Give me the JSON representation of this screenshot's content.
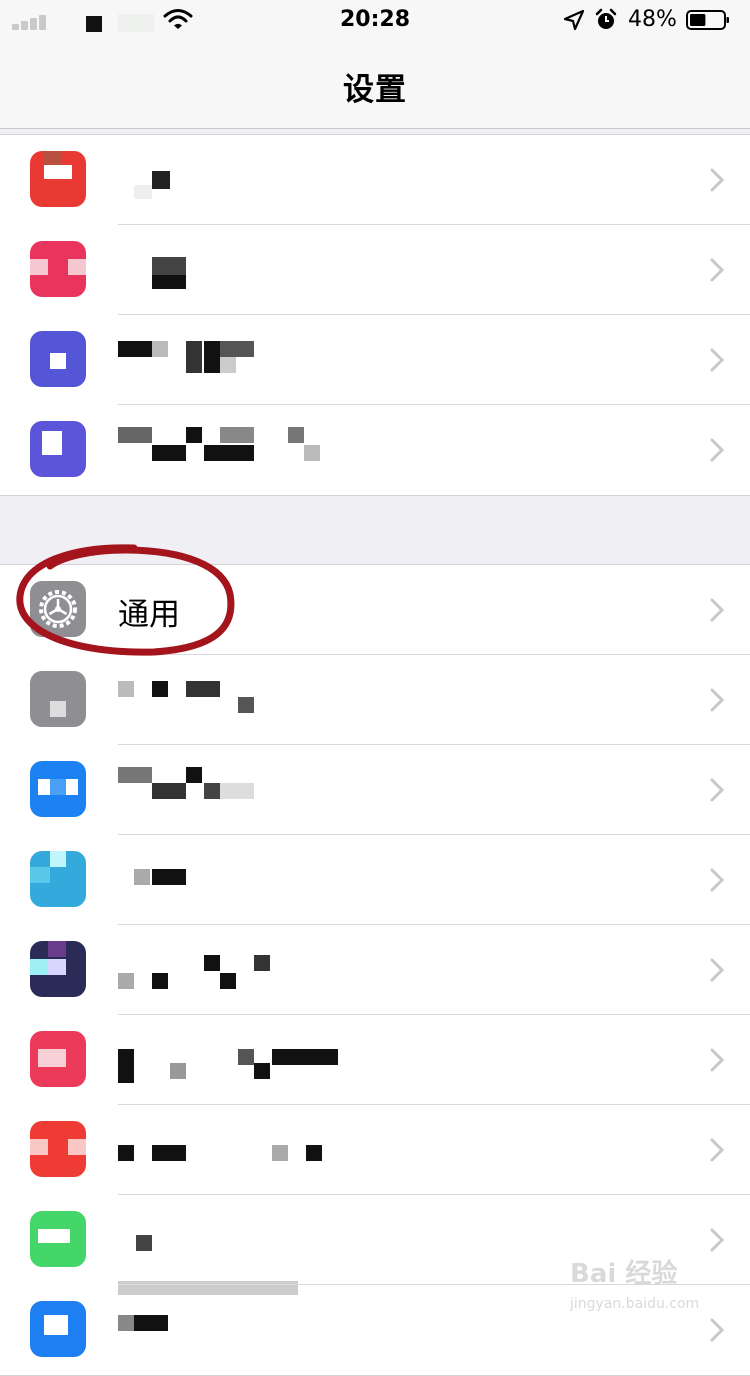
{
  "status_bar": {
    "time": "20:28",
    "battery_percent": "48%",
    "battery_level": 0.48
  },
  "nav": {
    "title": "设置"
  },
  "group1": {
    "rows": [
      {
        "icon": "app-icon-red",
        "color": "#e83a32"
      },
      {
        "icon": "app-icon-pink",
        "color": "#e9345d"
      },
      {
        "icon": "app-icon-indigo",
        "color": "#5456d6"
      },
      {
        "icon": "app-icon-violet",
        "color": "#5c55d9"
      }
    ]
  },
  "group2": {
    "rows": [
      {
        "label": "通用",
        "icon": "gear-icon",
        "color": "#8e8e93"
      },
      {
        "icon": "app-icon-gray",
        "color": "#8e8e93"
      },
      {
        "icon": "app-icon-blue",
        "color": "#1c82f2"
      },
      {
        "icon": "app-icon-cyan",
        "color": "#34aadc"
      },
      {
        "icon": "app-icon-purple",
        "color": "#2a2b56"
      },
      {
        "icon": "app-icon-pink",
        "color": "#ec3a5b"
      },
      {
        "icon": "app-icon-red",
        "color": "#ee3c35"
      },
      {
        "icon": "app-icon-green",
        "color": "#45d66a"
      },
      {
        "icon": "app-icon-blue",
        "color": "#1d7ff1"
      }
    ]
  },
  "watermark": {
    "text": "Bai 经验",
    "sub": "jingyan.baidu.com"
  }
}
